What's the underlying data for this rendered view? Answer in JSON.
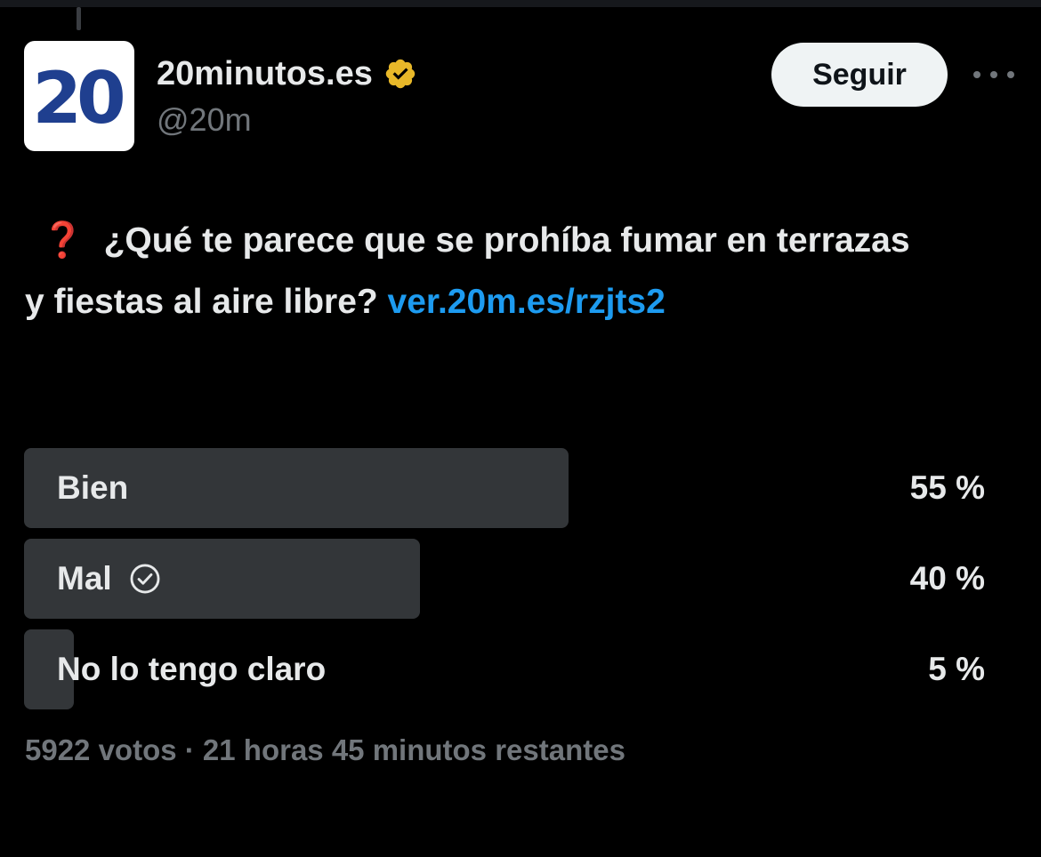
{
  "author": {
    "avatar_text": "20",
    "display_name": "20minutos.es",
    "handle": "@20m",
    "verified_badge": "verified-gold-badge-icon",
    "brand_color": "#1f3f8f"
  },
  "actions": {
    "follow_label": "Seguir",
    "more_icon": "ellipsis-icon"
  },
  "tweet": {
    "emoji": "❓",
    "text": "¿Qué te parece que se prohíba fumar en terrazas y fiestas al aire libre?",
    "link_text": "ver.20m.es/rzjts2",
    "link_color": "#1d9bf0"
  },
  "poll": {
    "options": [
      {
        "label": "Bien",
        "percent_text": "55 %",
        "share": 0.55,
        "selected": false
      },
      {
        "label": "Mal",
        "percent_text": "40 %",
        "share": 0.4,
        "selected": true
      },
      {
        "label": "No lo tengo claro",
        "percent_text": "5 %",
        "share": 0.05,
        "selected": false
      }
    ],
    "footer": "5922 votos · 21 horas 45 minutos restantes"
  }
}
